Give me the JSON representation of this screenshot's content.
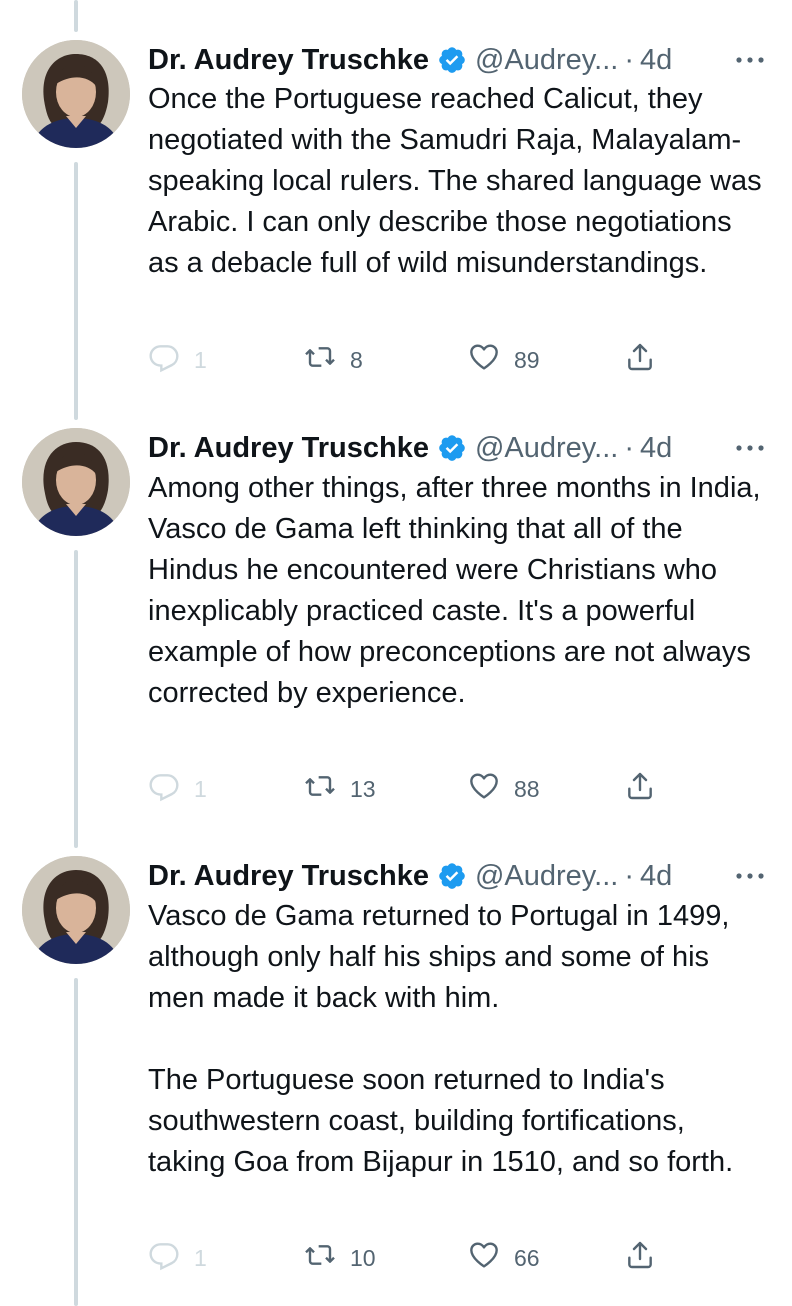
{
  "tweets": [
    {
      "author_name": "Dr. Audrey Truschke",
      "handle": "@Audrey...",
      "separator": "·",
      "time": "4d",
      "text": "Once the Portuguese reached Calicut, they negotiated with the Samudri Raja, Malayalam-speaking local rulers. The shared language was Arabic. I can only describe those negotiations as a debacle full of wild misunderstandings.",
      "replies": "1",
      "retweets": "8",
      "likes": "89"
    },
    {
      "author_name": "Dr. Audrey Truschke",
      "handle": "@Audrey...",
      "separator": "·",
      "time": "4d",
      "text": "Among other things, after three months in India, Vasco de Gama left thinking that all of the Hindus he encountered were Christians who inexplicably practiced caste. It's a powerful example of how preconceptions are not always corrected by experience.",
      "replies": "1",
      "retweets": "13",
      "likes": "88"
    },
    {
      "author_name": "Dr. Audrey Truschke",
      "handle": "@Audrey...",
      "separator": "·",
      "time": "4d",
      "text": "Vasco de Gama returned to Portugal in 1499, although only half his ships and some of his men made it back with him.\n\nThe Portuguese soon returned to India's southwestern coast, building fortifications, taking Goa from Bijapur in 1510, and so forth.",
      "replies": "1",
      "retweets": "10",
      "likes": "66"
    }
  ],
  "icons": {
    "verified": "verified-badge-icon",
    "more": "more-options-icon",
    "reply": "reply-icon",
    "retweet": "retweet-icon",
    "like": "heart-icon",
    "share": "share-icon"
  },
  "colors": {
    "text": "#0f1419",
    "secondary": "#536471",
    "verified": "#1d9bf0",
    "thread_line": "#cfd9de"
  }
}
